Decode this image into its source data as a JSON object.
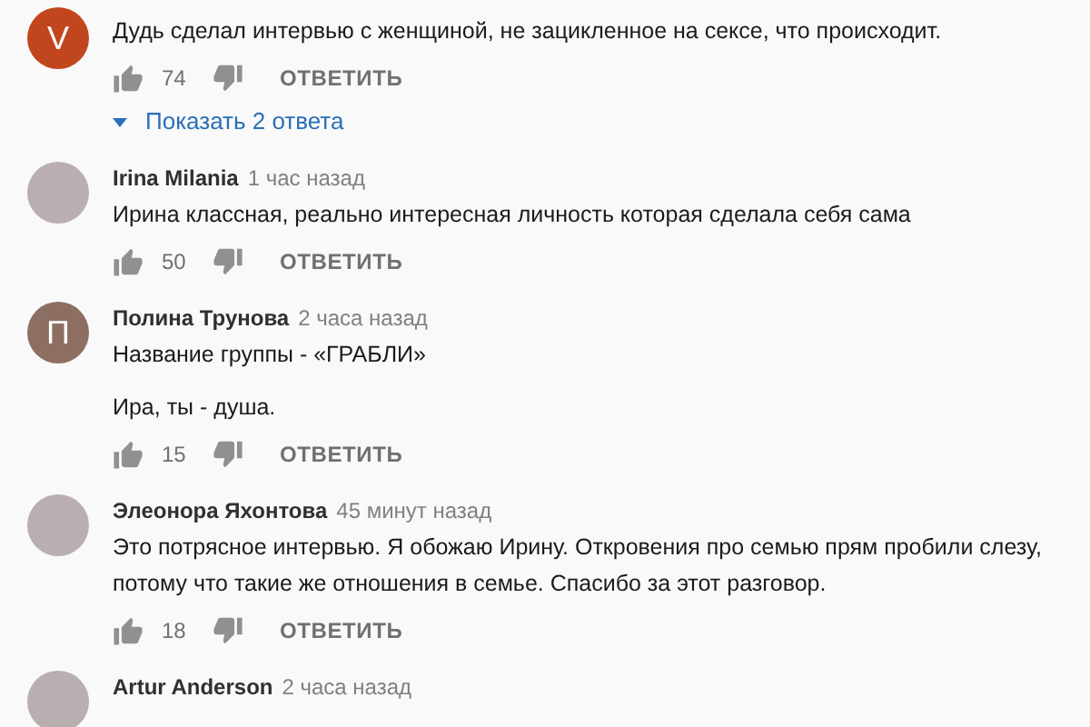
{
  "comments": [
    {
      "avatar": {
        "kind": "letter",
        "letter": "V",
        "color": "#c2461d"
      },
      "paragraphs": [
        "Дудь сделал интервью с женщиной, не зацикленное на сексе, что происходит."
      ],
      "likes": "74",
      "reply_label": "ОТВЕТИТЬ",
      "replies_link": "Показать 2 ответа"
    },
    {
      "author": "Irina Milania",
      "time": "1 час назад",
      "avatar": {
        "kind": "photo"
      },
      "paragraphs": [
        "Ирина классная, реально интересная личность которая сделала себя сама"
      ],
      "likes": "50",
      "reply_label": "ОТВЕТИТЬ"
    },
    {
      "author": "Полина Трунова",
      "time": "2 часа назад",
      "avatar": {
        "kind": "letter",
        "letter": "П",
        "color": "#8d6e63"
      },
      "paragraphs": [
        "Название группы - «ГРАБЛИ»",
        "Ира, ты - душа."
      ],
      "likes": "15",
      "reply_label": "ОТВЕТИТЬ"
    },
    {
      "author": "Элеонора Яхонтова",
      "time": "45 минут назад",
      "avatar": {
        "kind": "photo"
      },
      "paragraphs": [
        "Это потрясное интервью. Я обожаю Ирину. Откровения про семью прям пробили слезу, потому что такие же отношения в семье. Спасибо за этот разговор."
      ],
      "likes": "18",
      "reply_label": "ОТВЕТИТЬ"
    },
    {
      "author": "Artur Anderson",
      "time": "2 часа назад",
      "avatar": {
        "kind": "photo"
      }
    }
  ]
}
